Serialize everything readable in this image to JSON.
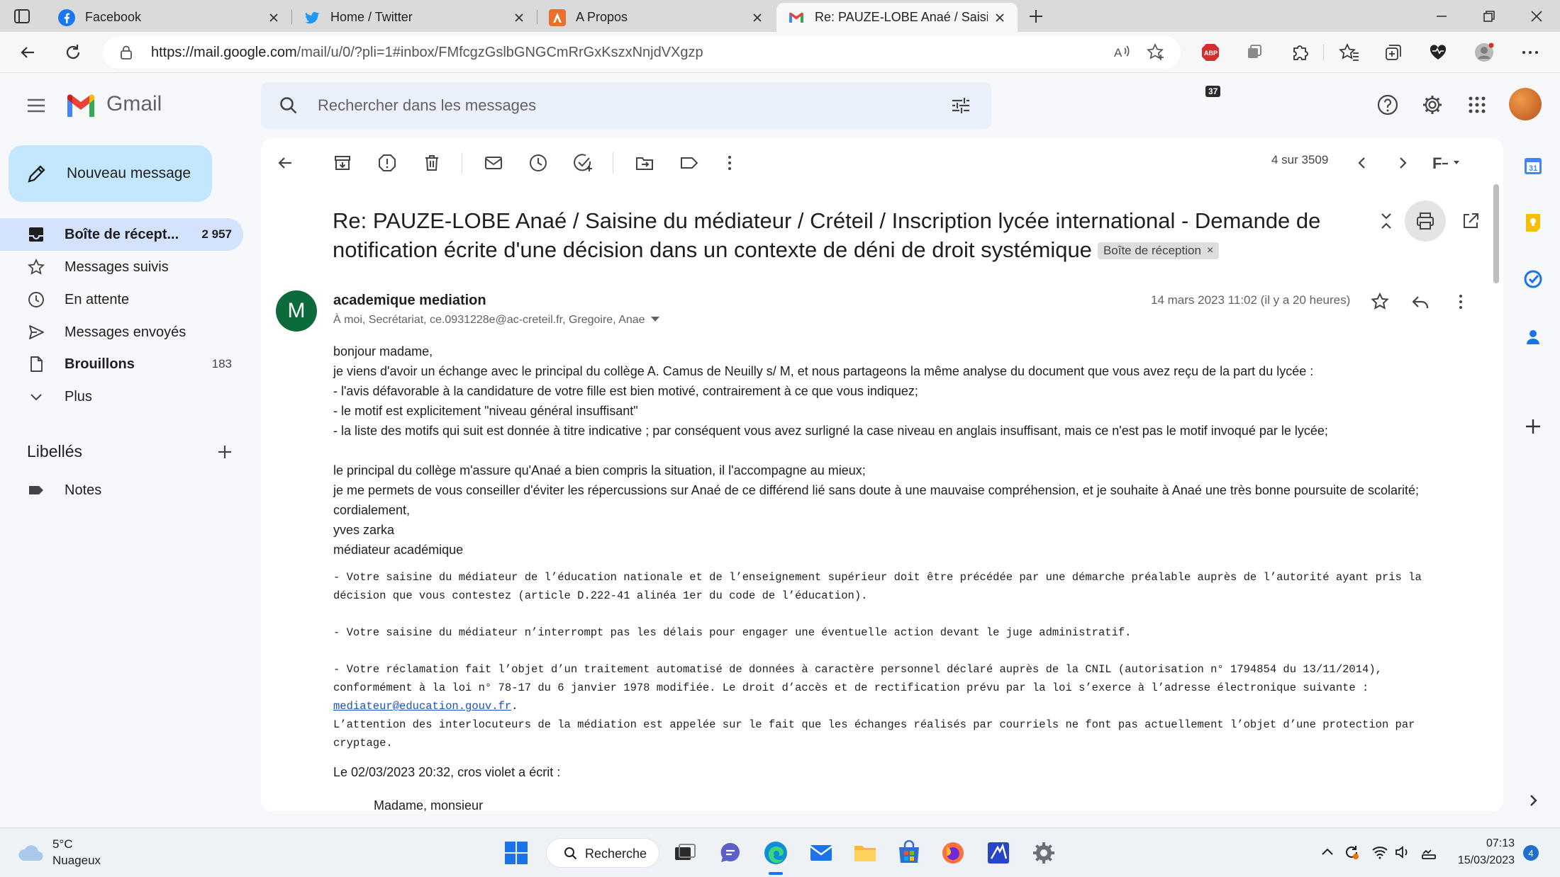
{
  "browser": {
    "tabs": [
      {
        "label": "Facebook",
        "icon": "facebook-icon",
        "active": false
      },
      {
        "label": "Home / Twitter",
        "icon": "twitter-icon",
        "active": false
      },
      {
        "label": "A Propos",
        "icon": "site-favicon-icon",
        "active": false
      },
      {
        "label": "Re: PAUZE-LOBE Anaé / Saisine du",
        "icon": "gmail-icon",
        "active": true
      }
    ],
    "url_host": "https://mail.google.com",
    "url_path": "/mail/u/0/?pli=1#inbox/FMfcgzGslbGNGCmRrGxKszxNnjdVXgzp",
    "extension_badge": "37"
  },
  "gmail": {
    "logo_text": "Gmail",
    "search_placeholder": "Rechercher dans les messages",
    "compose_label": "Nouveau message",
    "nav": [
      {
        "label": "Boîte de récept...",
        "count": "2 957",
        "icon": "inbox-icon"
      },
      {
        "label": "Messages suivis",
        "count": "",
        "icon": "star-icon"
      },
      {
        "label": "En attente",
        "count": "",
        "icon": "clock-icon"
      },
      {
        "label": "Messages envoyés",
        "count": "",
        "icon": "send-icon"
      },
      {
        "label": "Brouillons",
        "count": "183",
        "icon": "draft-icon"
      },
      {
        "label": "Plus",
        "count": "",
        "icon": "chevron-down-icon"
      }
    ],
    "labels_title": "Libellés",
    "labels": [
      {
        "label": "Notes",
        "icon": "label-icon"
      }
    ],
    "pager": "4 sur 3509"
  },
  "message": {
    "subject_line1": "Re: PAUZE-LOBE Anaé / Saisine du médiateur / Créteil / Inscription lycée international - Demande de",
    "subject_line2": "notification écrite d'une décision dans un contexte de déni de droit systémique",
    "inbox_badge": "Boîte de réception",
    "sender_initial": "M",
    "sender_name": "academique mediation",
    "recipients": "À moi, Secrétariat, ce.0931228e@ac-creteil.fr, Gregoire, Anae",
    "date": "14 mars 2023 11:02 (il y a 20 heures)",
    "body": [
      "bonjour madame,",
      "je viens d'avoir un échange avec le principal du collège A. Camus de Neuilly s/ M, et nous partageons la même analyse du document que vous avez reçu de la part du lycée :",
      "- l'avis défavorable à la candidature de votre fille est bien motivé, contrairement à ce que vous indiquez;",
      "- le motif est explicitement \"niveau général insuffisant\"",
      "- la liste des motifs qui suit est donnée à titre indicative ; par conséquent vous avez surligné la case niveau en anglais insuffisant, mais ce n'est pas le motif invoqué par le lycée;",
      "",
      "le principal du collège m'assure qu'Anaé a bien compris la situation, il l'accompagne au mieux;",
      "je me permets de vous conseiller d'éviter les répercussions sur Anaé  de ce différend lié sans doute à une mauvaise compréhension, et je souhaite à Anaé une très bonne poursuite de scolarité;",
      "cordialement,",
      "yves zarka",
      "médiateur académique"
    ],
    "footer_p1": [
      "- Votre saisine du médiateur de l’éducation nationale et de l’enseignement supérieur doit être précédée par une démarche préalable auprès de l’autorité ayant pris la",
      "décision que vous contestez (article D.222-41 alinéa 1er du code de l’éducation)."
    ],
    "footer_p2": "- Votre saisine du médiateur n’interrompt pas les délais pour engager une éventuelle action devant le juge administratif.",
    "footer_p3": [
      "- Votre réclamation fait l’objet d’un traitement automatisé de données à caractère personnel déclaré auprès de la CNIL (autorisation n° 1794854 du 13/11/2014),",
      "conformément à la loi n° 78-17 du 6 janvier 1978 modifiée. Le droit d’accès et de rectification prévu par la loi s’exerce à l’adresse électronique suivante :"
    ],
    "footer_link": "mediateur@education.gouv.fr",
    "footer_p3_tail": [
      "L’attention des interlocuteurs de la médiation est appelée sur le fait que les échanges réalisés par courriels ne font pas actuellement l’objet d’une protection par",
      "cryptage."
    ],
    "quote_header": "Le 02/03/2023 20:32, cros violet a écrit :",
    "quote_first_line": "Madame, monsieur"
  },
  "taskbar": {
    "temperature": "5°C",
    "condition": "Nuageux",
    "search_label": "Recherche",
    "time": "07:13",
    "date": "15/03/2023",
    "notifications": "4"
  },
  "colors": {
    "accent": "#0b57d0",
    "compose_bg": "#c2e7ff",
    "active_nav_bg": "#d3e3fd",
    "avatar_green": "#0b6b3a"
  }
}
